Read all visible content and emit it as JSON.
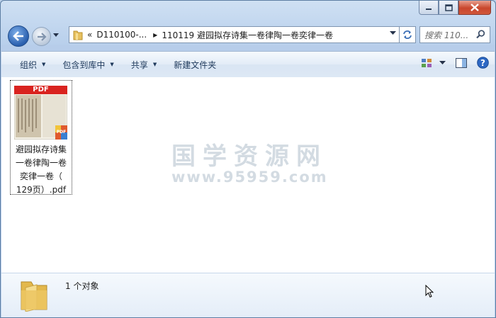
{
  "address": {
    "crumbs": [
      "«",
      "D110100-...",
      "110119 避园拟存诗集一卷律陶一卷奕律一卷"
    ]
  },
  "search": {
    "placeholder": "搜索 110..."
  },
  "toolbar": {
    "organize": "组织",
    "include_in_library": "包含到库中",
    "share": "共享",
    "new_folder": "新建文件夹"
  },
  "file": {
    "thumb_label": "PDF",
    "badge": "PDF",
    "name_lines": [
      "避园拟存诗集",
      "一卷律陶一卷",
      "奕律一卷（",
      "129页）.pdf"
    ]
  },
  "watermark": {
    "line1": "国学资源网",
    "line2": "www.95959.com"
  },
  "status": {
    "count": "1 个对象"
  },
  "colors": {
    "accent": "#1e395b",
    "pdf_red": "#d9231f",
    "close_red": "#c9462c"
  }
}
